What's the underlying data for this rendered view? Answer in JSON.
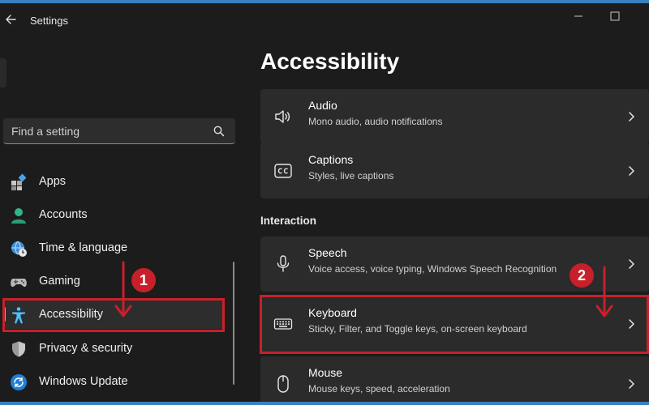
{
  "window": {
    "title": "Settings"
  },
  "colors": {
    "accent": "#4cc2ff",
    "annotation": "#c8202a",
    "background": "#1c1c1c",
    "card": "#2b2b2b"
  },
  "search": {
    "placeholder": "Find a setting"
  },
  "sidebar": {
    "items": [
      {
        "label": "Apps",
        "icon": "apps-icon"
      },
      {
        "label": "Accounts",
        "icon": "accounts-icon"
      },
      {
        "label": "Time & language",
        "icon": "globe-clock-icon"
      },
      {
        "label": "Gaming",
        "icon": "gamepad-icon"
      },
      {
        "label": "Accessibility",
        "icon": "accessibility-icon",
        "selected": true
      },
      {
        "label": "Privacy & security",
        "icon": "shield-icon"
      },
      {
        "label": "Windows Update",
        "icon": "update-icon"
      }
    ]
  },
  "main": {
    "title": "Accessibility",
    "section_interaction": "Interaction",
    "cards": [
      {
        "title": "Audio",
        "desc": "Mono audio, audio notifications",
        "icon": "speaker-icon"
      },
      {
        "title": "Captions",
        "desc": "Styles, live captions",
        "icon": "cc-icon"
      },
      {
        "title": "Speech",
        "desc": "Voice access, voice typing, Windows Speech Recognition",
        "icon": "microphone-icon"
      },
      {
        "title": "Keyboard",
        "desc": "Sticky, Filter, and Toggle keys, on-screen keyboard",
        "icon": "keyboard-icon"
      },
      {
        "title": "Mouse",
        "desc": "Mouse keys, speed, acceleration",
        "icon": "mouse-icon"
      }
    ]
  },
  "annotations": {
    "step1": "1",
    "step2": "2"
  }
}
